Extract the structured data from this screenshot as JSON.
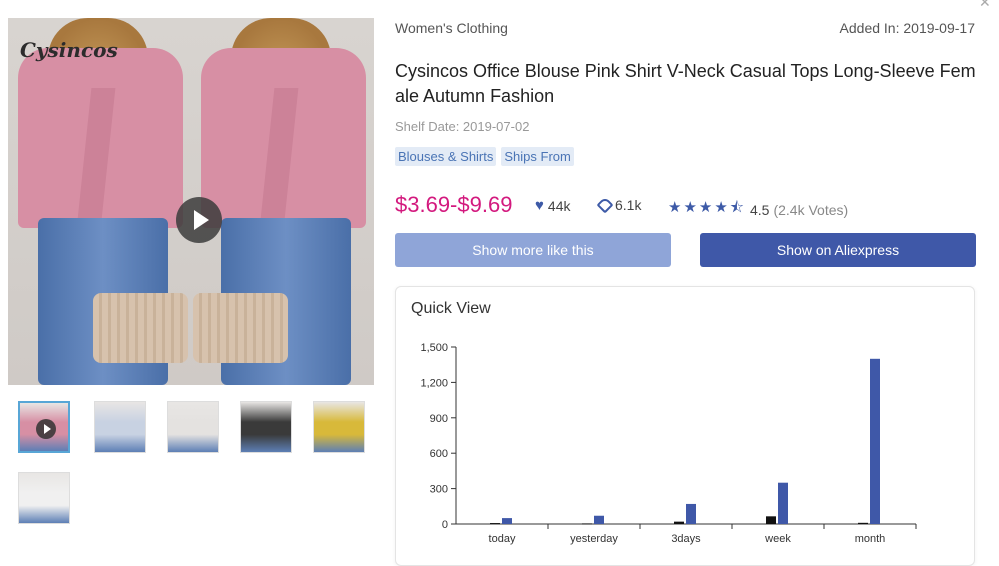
{
  "gallery": {
    "brand": "Cysincos",
    "thumb_colors": [
      "#d78fa4",
      "#c8d2e2",
      "#e4e2e0",
      "#3a3a3a",
      "#d8b93a",
      "#f0f0f0"
    ]
  },
  "header": {
    "category": "Women's Clothing",
    "added": "Added In: 2019-09-17"
  },
  "product": {
    "title": "Cysincos Office Blouse Pink Shirt V-Neck Casual Tops Long-Sleeve Female Autumn Fashion",
    "shelf_date": "Shelf Date: 2019-07-02",
    "tags": [
      "Blouses & Shirts",
      "Ships From"
    ],
    "price": "$3.69-$9.69",
    "likes": "44k",
    "orders": "6.1k",
    "rating": "4.5",
    "votes": "(2.4k Votes)"
  },
  "actions": {
    "more_label": "Show more like this",
    "ali_label": "Show on Aliexpress"
  },
  "quick_view": {
    "title": "Quick View"
  },
  "colors": {
    "accent": "#3f58a8",
    "price": "#d3197e",
    "bar_primary": "#3f58a8",
    "bar_secondary": "#111111"
  },
  "chart_data": {
    "type": "bar",
    "categories": [
      "today",
      "yesterday",
      "3days",
      "week",
      "month"
    ],
    "series": [
      {
        "values": [
          8,
          5,
          20,
          65,
          10
        ]
      },
      {
        "values": [
          50,
          70,
          170,
          350,
          1400
        ]
      }
    ],
    "yticks": [
      "0",
      "300",
      "600",
      "900",
      "1,200",
      "1,500"
    ],
    "ylim": [
      0,
      1500
    ]
  }
}
